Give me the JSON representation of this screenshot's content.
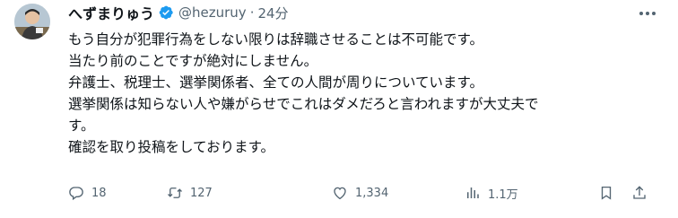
{
  "author": {
    "name": "へずまりゅう",
    "handle": "@hezuruy",
    "separator": "·",
    "time": "24分"
  },
  "tweet_lines": [
    "もう自分が犯罪行為をしない限りは辞職させることは不可能です。",
    "当たり前のことですが絶対にしません。",
    "弁護士、税理士、選挙関係者、全ての人間が周りについています。",
    "選挙関係は知らない人や嫌がらせでこれはダメだろと言われますが大丈夫で",
    "す。",
    "確認を取り投稿をしております。"
  ],
  "actions": {
    "reply_count": "18",
    "retweet_count": "127",
    "like_count": "1,334",
    "view_count": "1.1万"
  },
  "icons": {
    "verified": "verified-badge-icon",
    "more": "more-options-icon",
    "reply": "reply-icon",
    "retweet": "retweet-icon",
    "like": "heart-icon",
    "views": "views-icon",
    "bookmark": "bookmark-icon",
    "share": "share-icon"
  },
  "colors": {
    "verified": "#1d9bf0",
    "secondary_text": "#536471",
    "primary_text": "#0f1419"
  }
}
